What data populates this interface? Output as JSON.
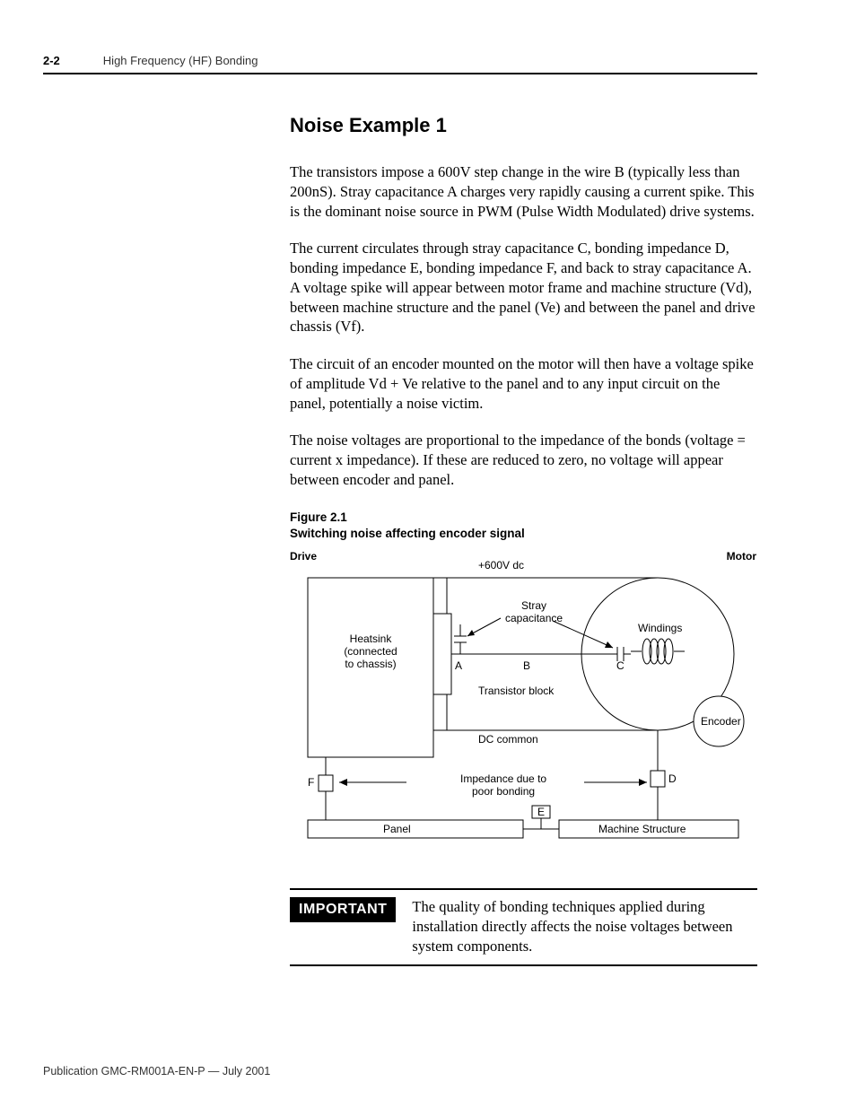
{
  "header": {
    "page_num": "2-2",
    "title": "High Frequency (HF) Bonding"
  },
  "section_heading": "Noise Example 1",
  "paragraphs": [
    "The transistors impose a 600V step change in the wire B (typically less than 200nS). Stray capacitance A charges very rapidly causing a current spike. This is the dominant noise source in PWM (Pulse Width Modulated) drive systems.",
    "The current circulates through stray capacitance C, bonding impedance D, bonding impedance E, bonding impedance F, and back to stray capacitance A. A voltage spike will appear between motor frame and machine structure (Vd), between machine structure and the panel (Ve) and between the panel and drive chassis (Vf).",
    "The circuit of an encoder mounted on the motor will then have a voltage spike of amplitude Vd + Ve relative to the panel and to any input circuit on the panel, potentially a noise victim.",
    "The noise voltages are proportional to the impedance of the bonds (voltage = current x impedance). If these are reduced to zero, no voltage will appear between encoder and panel."
  ],
  "figure": {
    "caption_line1": "Figure 2.1",
    "caption_line2": "Switching noise affecting encoder signal",
    "labels": {
      "drive": "Drive",
      "motor": "Motor",
      "plus600": "+600V dc",
      "stray": "Stray\ncapacitance",
      "windings": "Windings",
      "heatsink": "Heatsink\n(connected\nto chassis)",
      "A": "A",
      "B": "B",
      "C": "C",
      "D": "D",
      "E": "E",
      "F": "F",
      "transistor": "Transistor block",
      "dccommon": "DC common",
      "impedance": "Impedance due to\npoor bonding",
      "panel": "Panel",
      "machine": "Machine Structure",
      "encoder": "Encoder"
    }
  },
  "important": {
    "tag": "IMPORTANT",
    "text": "The quality of bonding techniques applied during installation directly affects the noise voltages between system components."
  },
  "footer": "Publication GMC-RM001A-EN-P — July 2001"
}
